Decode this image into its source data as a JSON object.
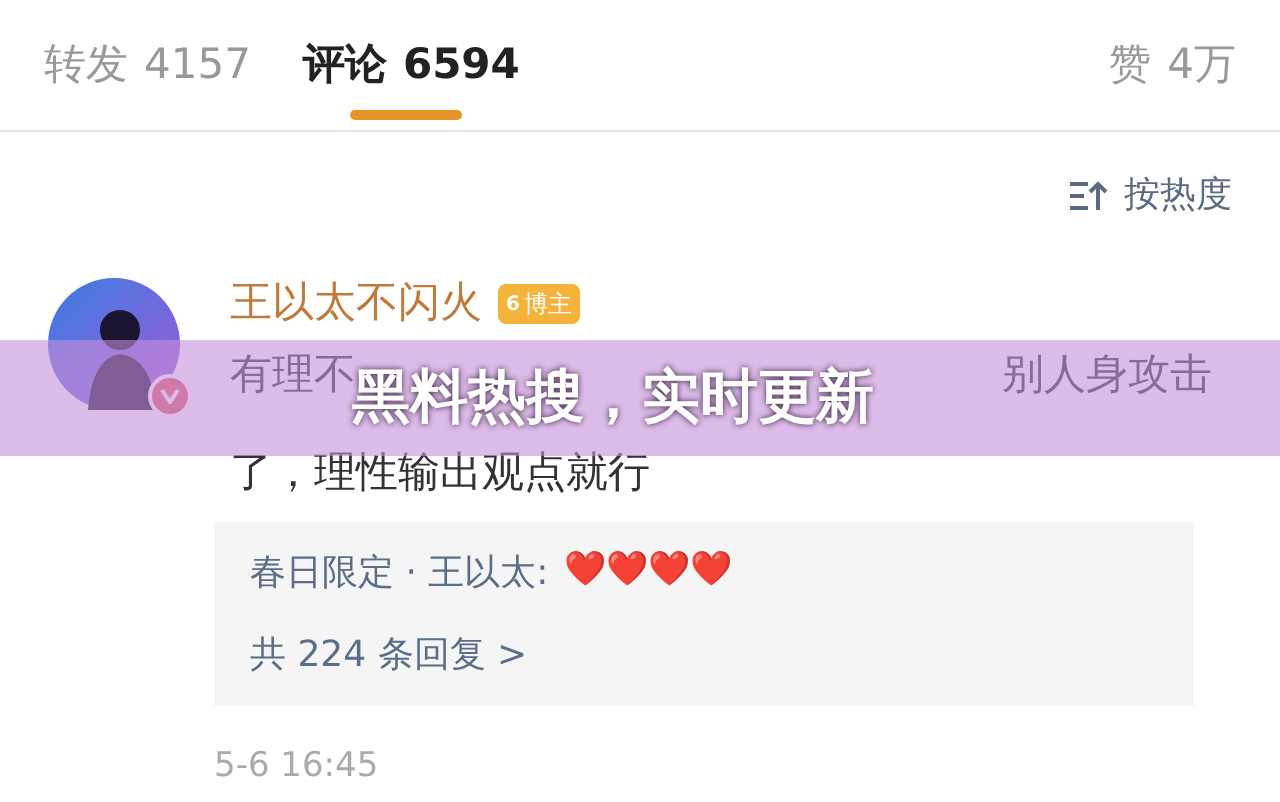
{
  "tabs": [
    {
      "label": "转发",
      "count": "4157",
      "selected": false
    },
    {
      "label": "评论",
      "count": "6594",
      "selected": true
    }
  ],
  "likes": {
    "label": "赞",
    "count": "4万"
  },
  "sort": {
    "label": "按热度"
  },
  "comment": {
    "author": "王以太不闪火",
    "badge_level": "6",
    "badge": "博主",
    "verified": true,
    "line_1_visible": [
      "有理不",
      "别人身攻击"
    ],
    "line_2": "了，理性输出观点就行",
    "reply": {
      "author": "春日限定 · 王以太:",
      "hearts": "❤️❤️❤️❤️",
      "more": "共 224 条回复 >"
    },
    "time": "5-6 16:45"
  },
  "banner": {
    "text": "黑料热搜，实时更新"
  }
}
